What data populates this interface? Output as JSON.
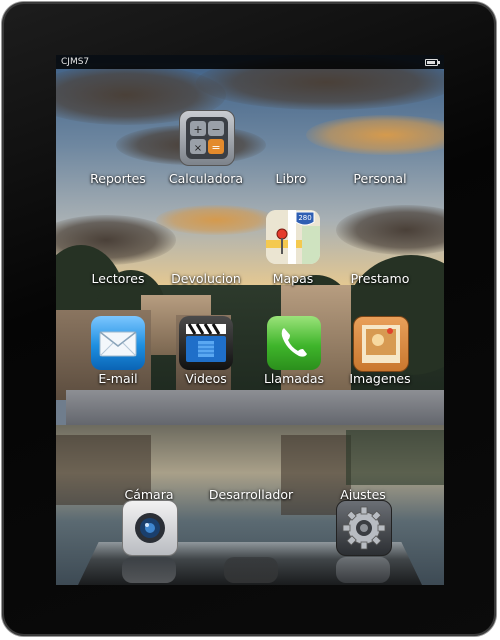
{
  "status_bar": {
    "carrier": "CJMS7",
    "battery_icon": "battery-icon"
  },
  "apps_row1": [
    {
      "label": "Reportes"
    },
    {
      "label": "Calculadora",
      "icon": "calculator-icon"
    },
    {
      "label": "Libro"
    },
    {
      "label": "Personal"
    }
  ],
  "apps_row2": [
    {
      "label": "Lectores"
    },
    {
      "label": "Devolucion"
    },
    {
      "label": "Mapas",
      "icon": "maps-icon",
      "badge": "280"
    },
    {
      "label": "Prestamo"
    }
  ],
  "apps_row3": [
    {
      "label": "E-mail",
      "icon": "mail-icon"
    },
    {
      "label": "Videos",
      "icon": "videos-icon"
    },
    {
      "label": "Llamadas",
      "icon": "phone-icon"
    },
    {
      "label": "Imagenes",
      "icon": "photos-icon"
    }
  ],
  "dock": [
    {
      "label": "Cámara",
      "icon": "camera-icon"
    },
    {
      "label": "Desarrollador"
    },
    {
      "label": "Ajustes",
      "icon": "settings-gear-icon"
    }
  ],
  "colors": {
    "mail": "#1e8fe0",
    "videos": "#1d1d1d",
    "phone": "#3fb52b",
    "photos": "#c9772e",
    "calculator": "#8a8f96"
  }
}
